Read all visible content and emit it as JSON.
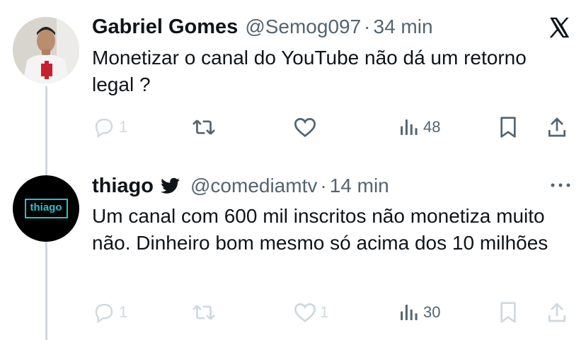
{
  "tweets": [
    {
      "name": "Gabriel Gomes",
      "handle": "@Semog097",
      "separator": "·",
      "time": "34 min",
      "text": "Monetizar o canal do YouTube não dá um retorno legal ?",
      "stats": {
        "replies": "1",
        "views": "48"
      },
      "icons": [
        "reply-icon",
        "retweet-icon",
        "like-icon",
        "views-icon",
        "bookmark-icon",
        "share-icon",
        "x-logo-icon"
      ]
    },
    {
      "name": "thiago",
      "avatar_text": "thiago",
      "handle": "@comediamtv",
      "separator": "·",
      "time": "14 min",
      "text": "Um canal com 600 mil inscritos não monetiza muito não. Dinheiro bom mesmo só acima dos 10 milhões",
      "stats": {
        "replies": "1",
        "likes": "1",
        "views": "30"
      },
      "icons": [
        "reply-icon",
        "retweet-icon",
        "like-icon",
        "views-icon",
        "bookmark-icon",
        "share-icon",
        "bird-icon",
        "more-icon"
      ]
    }
  ],
  "colors": {
    "text": "#0f1419",
    "secondary": "#536471",
    "faint": "#cfd9de",
    "thread_line": "#cfd9de",
    "logo_accent": "#27c2c9"
  }
}
